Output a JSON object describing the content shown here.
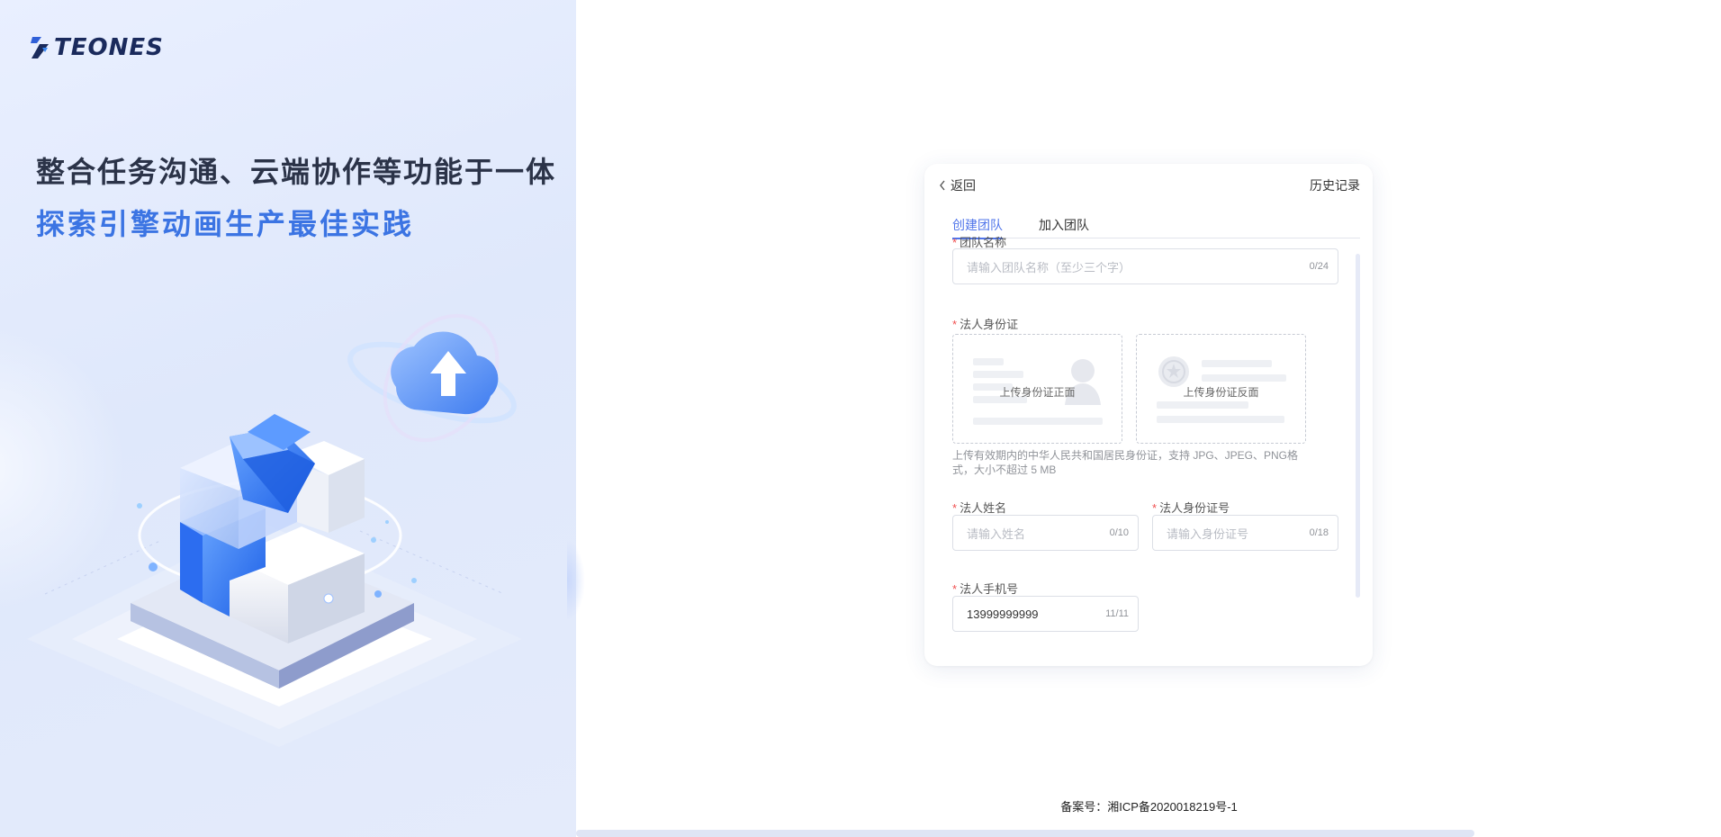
{
  "brand": {
    "logo_text": "TEONES",
    "accent_color": "#3b74e3",
    "tab_active_color": "#4f74ea",
    "required_color": "#f05050"
  },
  "hero": {
    "title": "整合任务沟通、云端协作等功能于一体",
    "subtitle": "探索引擎动画生产最佳实践"
  },
  "card": {
    "back_label": "返回",
    "history_label": "历史记录",
    "tabs": [
      {
        "label": "创建团队",
        "active": true
      },
      {
        "label": "加入团队",
        "active": false
      }
    ],
    "form": {
      "team_name": {
        "label": "团队名称",
        "placeholder": "请输入团队名称（至少三个字）",
        "counter": "0/24"
      },
      "legal_id": {
        "label": "法人身份证",
        "front_label": "上传身份证正面",
        "back_label": "上传身份证反面",
        "hint": "上传有效期内的中华人民共和国居民身份证，支持 JPG、JPEG、PNG格式，大小不超过 5 MB"
      },
      "legal_name": {
        "label": "法人姓名",
        "placeholder": "请输入姓名",
        "counter": "0/10"
      },
      "legal_id_number": {
        "label": "法人身份证号",
        "placeholder": "请输入身份证号",
        "counter": "0/18"
      },
      "legal_phone": {
        "label": "法人手机号",
        "value": "13999999999",
        "counter": "11/11"
      }
    }
  },
  "footer": {
    "icp": "备案号：湘ICP备2020018219号-1"
  }
}
